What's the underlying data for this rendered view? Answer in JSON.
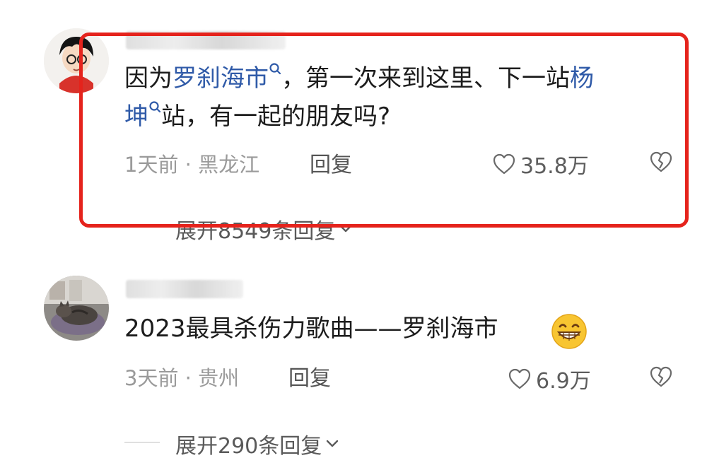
{
  "comments": [
    {
      "text_parts": [
        "因为",
        "罗刹海市",
        "，第一次来到这里、下一站",
        "杨",
        "坤",
        "站，有一起的朋友吗?"
      ],
      "meta": "1天前 · 黑龙江",
      "reply_label": "回复",
      "likes": "35.8万",
      "expand_label": "展开8549条回复"
    },
    {
      "text": "2023最具杀伤力歌曲——罗刹海市",
      "meta": "3天前 · 贵州",
      "reply_label": "回复",
      "likes": "6.9万",
      "expand_label": "展开290条回复"
    }
  ],
  "colors": {
    "highlight_border": "#e5231c",
    "link": "#2f5aa8",
    "meta": "#9a9a9a"
  },
  "icons": [
    "search-icon",
    "heart-icon",
    "broken-heart-icon",
    "chevron-down-icon",
    "grinning-emoji"
  ]
}
